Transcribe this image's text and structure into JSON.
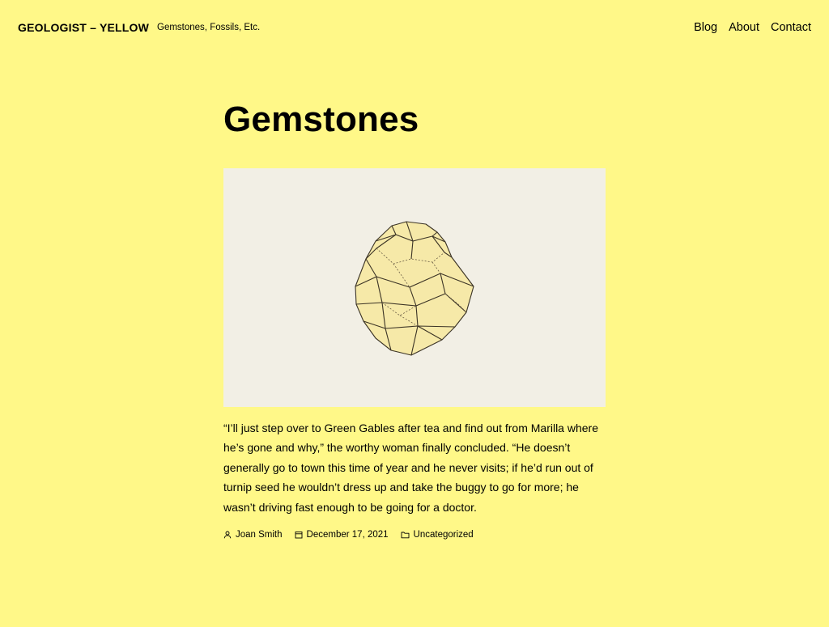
{
  "header": {
    "site_title": "GEOLOGIST – YELLOW",
    "tagline": "Gemstones, Fossils, Etc."
  },
  "nav": {
    "items": [
      {
        "label": "Blog"
      },
      {
        "label": "About"
      },
      {
        "label": "Contact"
      }
    ]
  },
  "post": {
    "title": "Gemstones",
    "excerpt": "“I’ll just step over to Green Gables after tea and find out from Marilla where he’s gone and why,” the worthy woman finally concluded. “He doesn’t generally go to town this time of year and he never visits; if he’d run out of turnip seed he wouldn’t dress up and take the buggy to go for more; he wasn’t driving fast enough to be going for a doctor.",
    "author": "Joan Smith",
    "date": "December 17, 2021",
    "category": "Uncategorized"
  },
  "icons": {
    "author": "user-icon",
    "date": "calendar-icon",
    "category": "folder-icon"
  },
  "colors": {
    "background": "#fff888",
    "image_background": "#f2efe5",
    "crystal_fill": "#f6e9a8",
    "crystal_edge": "#3b3325"
  }
}
